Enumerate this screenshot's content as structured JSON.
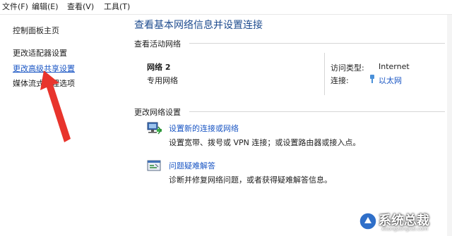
{
  "menu": {
    "file": "文件(F)",
    "edit": "编辑(E)",
    "view": "查看(V)",
    "tools": "工具(T)"
  },
  "sidebar": {
    "items": [
      {
        "label": "控制面板主页"
      },
      {
        "label": "更改适配器设置"
      },
      {
        "label": "更改高级共享设置"
      },
      {
        "label": "媒体流式处理选项"
      }
    ]
  },
  "main": {
    "title": "查看基本网络信息并设置连接",
    "active_networks_label": "查看活动网络",
    "network": {
      "name": "网络 2",
      "category": "专用网络",
      "access_type_label": "访问类型:",
      "access_type_value": "Internet",
      "connections_label": "连接:",
      "connections_value": "以太网"
    },
    "change_settings_label": "更改网络设置",
    "tasks": [
      {
        "title": "设置新的连接或网络",
        "description": "设置宽带、拨号或 VPN 连接；或设置路由器或接入点。",
        "icon": "network-setup-icon"
      },
      {
        "title": "问题疑难解答",
        "description": "诊断并修复网络问题，或者获得疑难解答信息。",
        "icon": "troubleshoot-icon"
      }
    ]
  },
  "watermark": {
    "text": "系统总裁",
    "url": "xitongzongcai.com"
  },
  "colors": {
    "link": "#1a56c4",
    "title": "#1f4c8f",
    "annotation_arrow": "#e8342c"
  }
}
